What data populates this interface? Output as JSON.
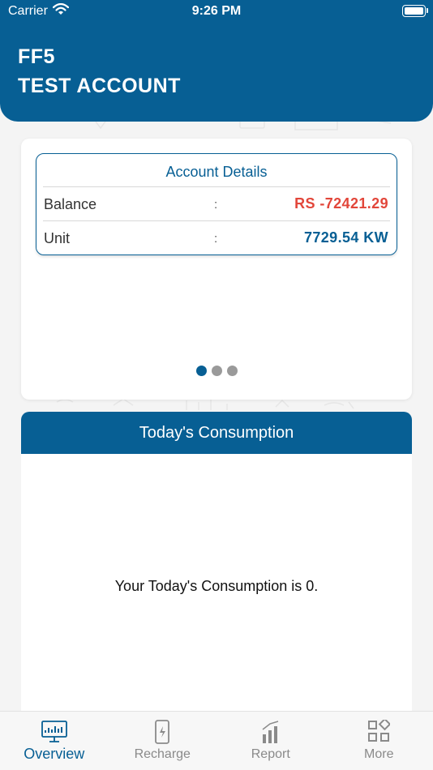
{
  "status_bar": {
    "carrier": "Carrier",
    "time": "9:26 PM"
  },
  "header": {
    "line1": "FF5",
    "line2": "TEST ACCOUNT"
  },
  "account": {
    "title": "Account Details",
    "rows": [
      {
        "label": "Balance",
        "separator": ":",
        "value": "RS -72421.29",
        "color": "#e2463a"
      },
      {
        "label": "Unit",
        "separator": ":",
        "value": "7729.54 KW",
        "color": "#075f94"
      }
    ],
    "pager": {
      "pages": 3,
      "current": 1
    }
  },
  "consumption": {
    "title": "Today's Consumption",
    "message": "Your Today's Consumption is 0."
  },
  "tabs": [
    {
      "label": "Overview",
      "icon": "monitor-chart-icon",
      "active": true
    },
    {
      "label": "Recharge",
      "icon": "phone-bolt-icon",
      "active": false
    },
    {
      "label": "Report",
      "icon": "bar-chart-icon",
      "active": false
    },
    {
      "label": "More",
      "icon": "grid-icon",
      "active": false
    }
  ],
  "colors": {
    "primary": "#075f94",
    "negative": "#e2463a",
    "background": "#f4f4f4"
  }
}
